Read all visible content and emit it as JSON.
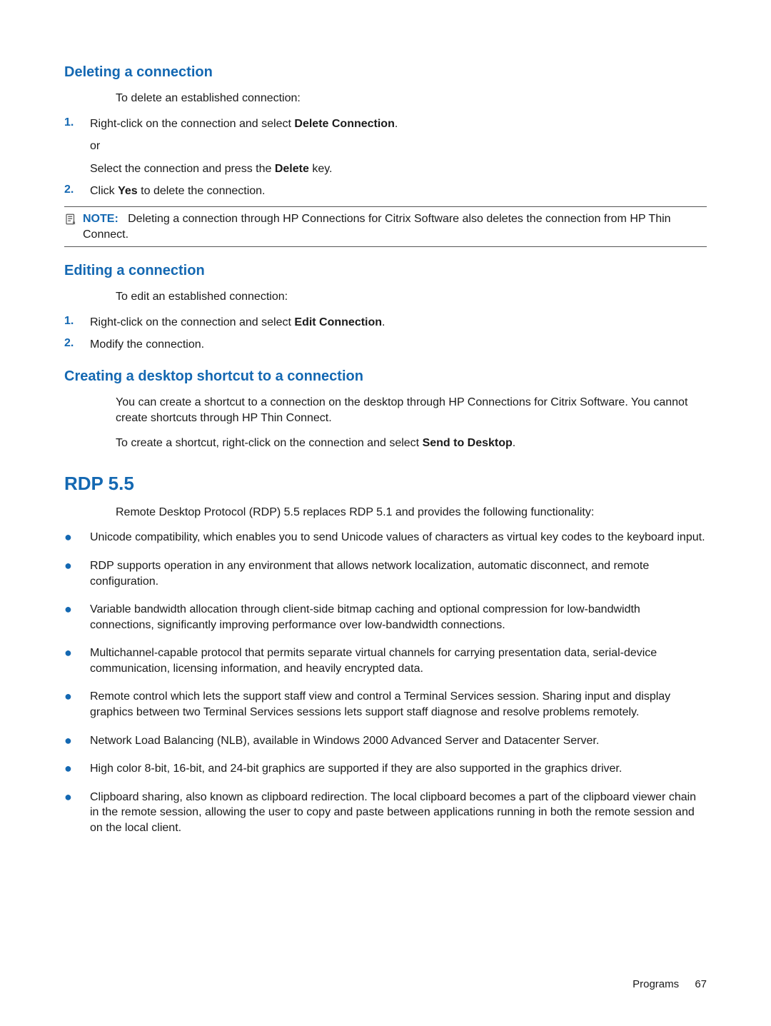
{
  "sections": {
    "delete": {
      "heading": "Deleting a connection",
      "intro": "To delete an established connection:",
      "steps": [
        {
          "num": "1.",
          "text_a": "Right-click on the connection and select ",
          "bold_a": "Delete Connection",
          "text_b": ".",
          "or": "or",
          "text_c": "Select the connection and press the ",
          "bold_b": "Delete",
          "text_d": " key."
        },
        {
          "num": "2.",
          "text_a": "Click ",
          "bold_a": "Yes",
          "text_b": " to delete the connection."
        }
      ]
    },
    "note": {
      "label": "NOTE:",
      "text": "Deleting a connection through HP Connections for Citrix Software also deletes the connection from HP Thin Connect."
    },
    "edit": {
      "heading": "Editing a connection",
      "intro": "To edit an established connection:",
      "steps": [
        {
          "num": "1.",
          "text_a": "Right-click on the connection and select ",
          "bold_a": "Edit Connection",
          "text_b": "."
        },
        {
          "num": "2.",
          "text_a": "Modify the connection."
        }
      ]
    },
    "shortcut": {
      "heading": "Creating a desktop shortcut to a connection",
      "para1": "You can create a shortcut to a connection on the desktop through HP Connections for Citrix Software. You cannot create shortcuts through HP Thin Connect.",
      "para2_a": "To create a shortcut, right-click on the connection and select ",
      "para2_bold": "Send to Desktop",
      "para2_b": "."
    },
    "rdp": {
      "heading": "RDP 5.5",
      "intro": "Remote Desktop Protocol (RDP) 5.5 replaces RDP 5.1 and provides the following functionality:",
      "bullets": [
        "Unicode compatibility, which enables you to send Unicode values of characters as virtual key codes to the keyboard input.",
        "RDP supports operation in any environment that allows network localization, automatic disconnect, and remote configuration.",
        "Variable bandwidth allocation through client-side bitmap caching and optional compression for low-bandwidth connections, significantly improving performance over low-bandwidth connections.",
        "Multichannel-capable protocol that permits separate virtual channels for carrying presentation data, serial-device communication, licensing information, and heavily encrypted data.",
        "Remote control which lets the support staff view and control a Terminal Services session. Sharing input and display graphics between two Terminal Services sessions lets support staff diagnose and resolve problems remotely.",
        "Network Load Balancing (NLB), available in Windows 2000 Advanced Server and Datacenter Server.",
        "High color 8-bit, 16-bit, and 24-bit graphics are supported if they are also supported in the graphics driver.",
        "Clipboard sharing, also known as clipboard redirection. The local clipboard becomes a part of the clipboard viewer chain in the remote session, allowing the user to copy and paste between applications running in both the remote session and on the local client."
      ]
    }
  },
  "footer": {
    "label": "Programs",
    "page": "67"
  }
}
